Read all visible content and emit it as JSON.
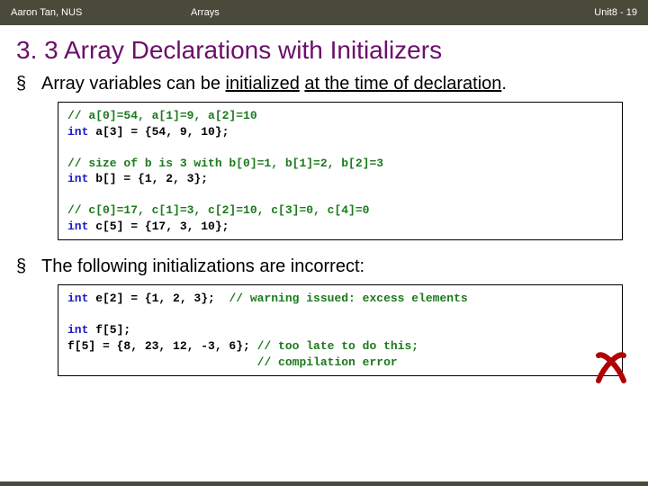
{
  "header": {
    "author": "Aaron Tan, NUS",
    "subject": "Arrays",
    "unit": "Unit8 - 19"
  },
  "title": "3. 3 Array Declarations with Initializers",
  "bullet1": {
    "marker": "§",
    "pre": "Array variables can be ",
    "u1": "initialized",
    "mid": " ",
    "u2": "at the time of declaration",
    "post": "."
  },
  "code1": {
    "c1": "// a[0]=54, a[1]=9, a[2]=10",
    "k1": "int",
    "l1": " a[3] = {54, 9, 10};",
    "c2": "// size of b is 3 with b[0]=1, b[1]=2, b[2]=3",
    "k2": "int",
    "l2": " b[] = {1, 2, 3};",
    "c3": "// c[0]=17, c[1]=3, c[2]=10, c[3]=0, c[4]=0",
    "k3": "int",
    "l3": " c[5] = {17, 3, 10};"
  },
  "bullet2": {
    "marker": "§",
    "text": "The following initializations are incorrect:"
  },
  "code2": {
    "k1": "int",
    "l1a": " e[2] = {1, 2, 3};  ",
    "c1": "// warning issued: excess elements",
    "k2": "int",
    "l2": " f[5];",
    "l3a": "f[5] = {8, 23, 12, -3, 6}; ",
    "c3a": "// too late to do this;",
    "pad": "                           ",
    "c3b": "// compilation error"
  },
  "icons": {
    "cross": "cross-icon"
  }
}
